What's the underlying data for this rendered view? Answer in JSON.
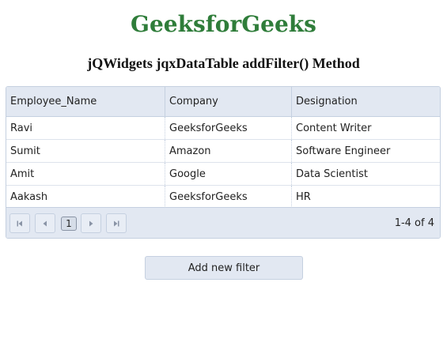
{
  "site_title": "GeeksforGeeks",
  "page_heading": "jQWidgets jqxDataTable addFilter() Method",
  "table": {
    "columns": [
      "Employee_Name",
      "Company",
      "Designation"
    ],
    "rows": [
      [
        "Ravi",
        "GeeksforGeeks",
        "Content Writer"
      ],
      [
        "Sumit",
        "Amazon",
        "Software Engineer"
      ],
      [
        "Amit",
        "Google",
        "Data Scientist"
      ],
      [
        "Aakash",
        "GeeksforGeeks",
        "HR"
      ]
    ]
  },
  "pager": {
    "current_page": "1",
    "info": "1-4 of 4",
    "icons": [
      "first-page-icon",
      "previous-page-icon",
      "next-page-icon",
      "last-page-icon"
    ]
  },
  "add_filter_button": "Add new filter",
  "colors": {
    "title_green": "#2f7d3a",
    "header_bg": "#e2e8f2",
    "border": "#c5d0e0"
  }
}
